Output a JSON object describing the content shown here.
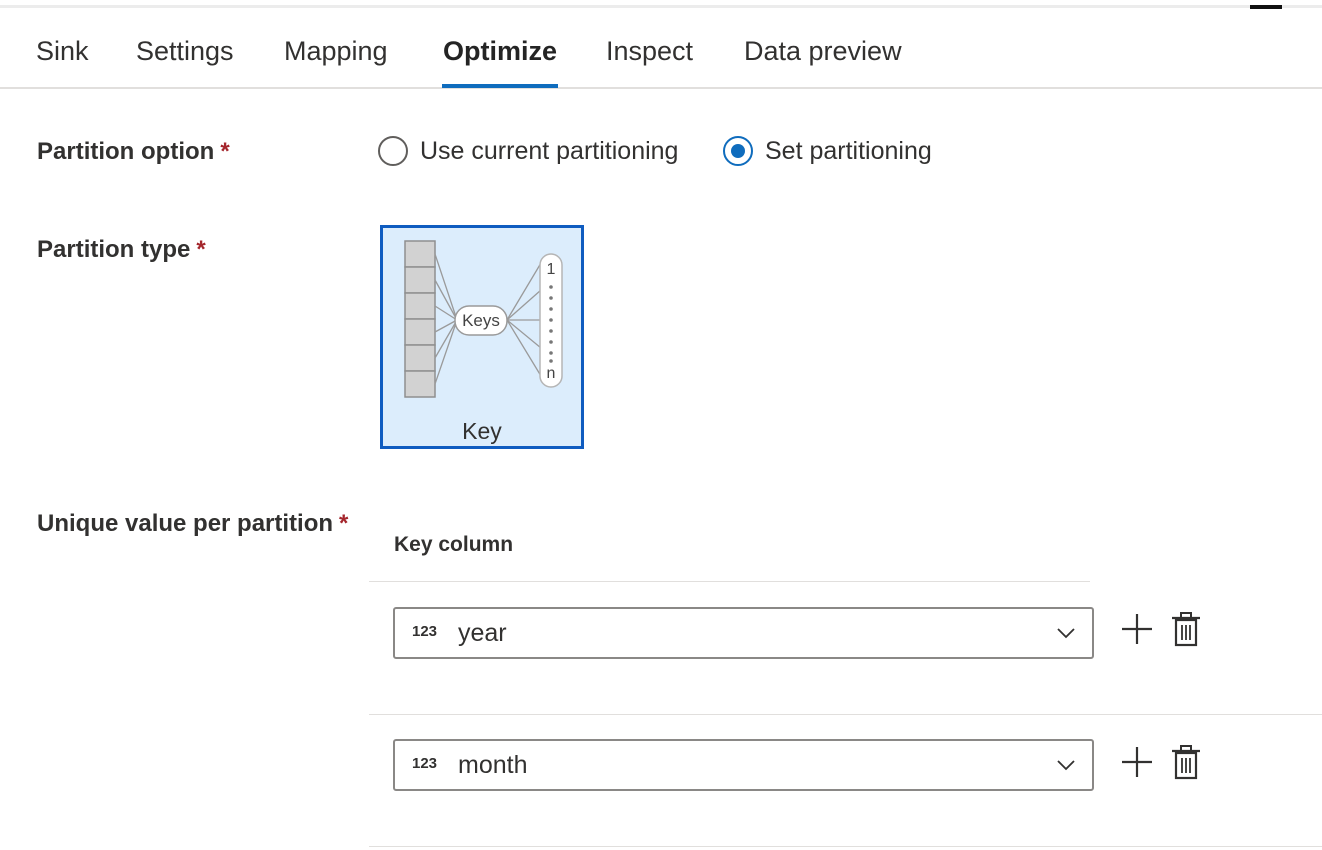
{
  "tabs": [
    {
      "label": "Sink",
      "active": false
    },
    {
      "label": "Settings",
      "active": false
    },
    {
      "label": "Mapping",
      "active": false
    },
    {
      "label": "Optimize",
      "active": true
    },
    {
      "label": "Inspect",
      "active": false
    },
    {
      "label": "Data preview",
      "active": false
    }
  ],
  "partition_option": {
    "label": "Partition option",
    "required_mark": "*",
    "options": [
      {
        "label": "Use current partitioning",
        "selected": false
      },
      {
        "label": "Set partitioning",
        "selected": true
      }
    ]
  },
  "partition_type": {
    "label": "Partition type",
    "required_mark": "*",
    "selected": {
      "label": "Key",
      "diagram": {
        "center_label": "Keys",
        "range_start": "1",
        "range_end": "n"
      }
    }
  },
  "unique_value": {
    "label": "Unique value per partition",
    "required_mark": "*",
    "column_header": "Key column",
    "rows": [
      {
        "type_icon": "123",
        "value": "year"
      },
      {
        "type_icon": "123",
        "value": "month"
      }
    ]
  },
  "colors": {
    "accent": "#0f6cbd",
    "tile_border": "#0f5cc0",
    "tile_background": "#dcedfc",
    "required": "#a4262c"
  }
}
